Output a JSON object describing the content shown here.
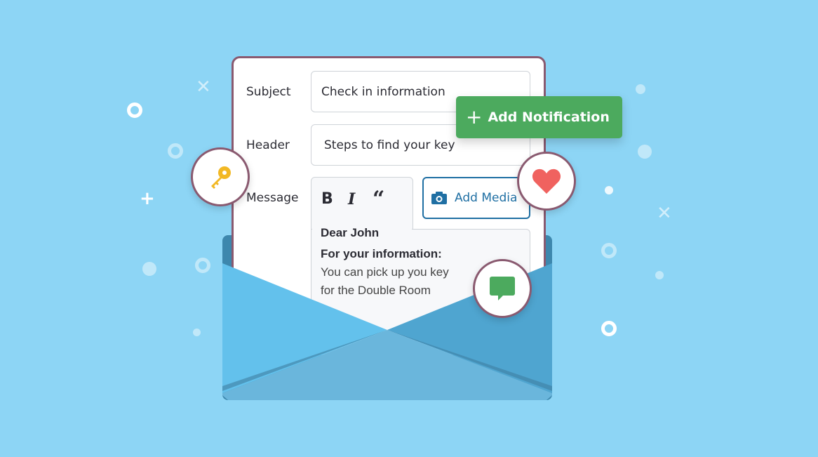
{
  "form": {
    "subject_label": "Subject",
    "subject_value": "Check in information",
    "header_label": "Header",
    "header_value": "Steps to find your key",
    "message_label": "Message",
    "toolbar": {
      "bold": "B",
      "italic": "I",
      "quote": "66"
    },
    "add_media_label": "Add Media",
    "message_lines": [
      "Dear John",
      "For your information:",
      "You can pick up you key",
      "for the Double Room"
    ]
  },
  "add_notification_label": "Add Notification",
  "badges": [
    "key-icon",
    "heart-icon",
    "chat-icon"
  ],
  "colors": {
    "background": "#8dd5f5",
    "accent_green": "#4caa5e",
    "accent_blue": "#1f6fa3",
    "border": "#8a5a70",
    "heart": "#f0625f",
    "key": "#f2b824"
  }
}
